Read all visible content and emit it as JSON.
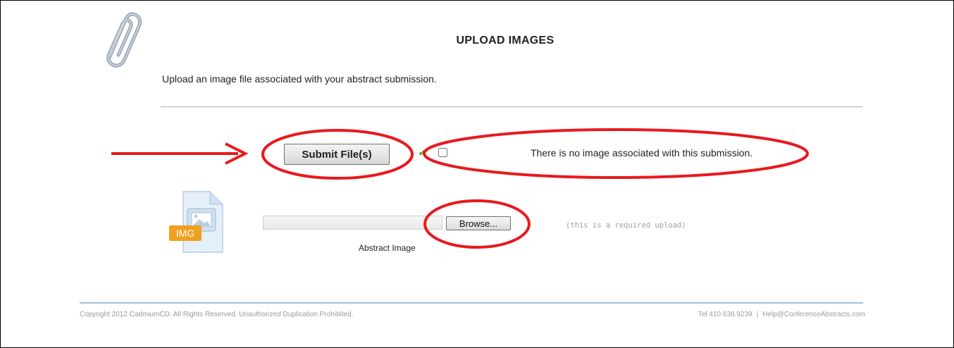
{
  "header": {
    "title": "UPLOAD IMAGES",
    "intro": "Upload an image file associated with your abstract submission."
  },
  "actions": {
    "submit_label": "Submit File(s)",
    "check_mark": "✔",
    "no_image_label": "There is no image associated with this submission."
  },
  "upload": {
    "badge_text": "IMG",
    "browse_label": "Browse...",
    "required_note": "(this is a required upload)",
    "caption": "Abstract Image"
  },
  "footer": {
    "copyright": "Copyright 2012 CadmiumCD. All Rights Reserved. Unauthorized Duplication Prohibited.",
    "phone": "Tel 410.638.9239",
    "separator": "|",
    "email": "Help@ConferenceAbstracts.com"
  },
  "colors": {
    "annotation_red": "#e8191e",
    "check_green": "#5aa12b",
    "footer_line": "#9fbfe0",
    "badge_orange": "#f0a020"
  },
  "icons": {
    "logo": "paperclip-icon",
    "file": "image-file-icon",
    "check": "checkmark-icon"
  }
}
